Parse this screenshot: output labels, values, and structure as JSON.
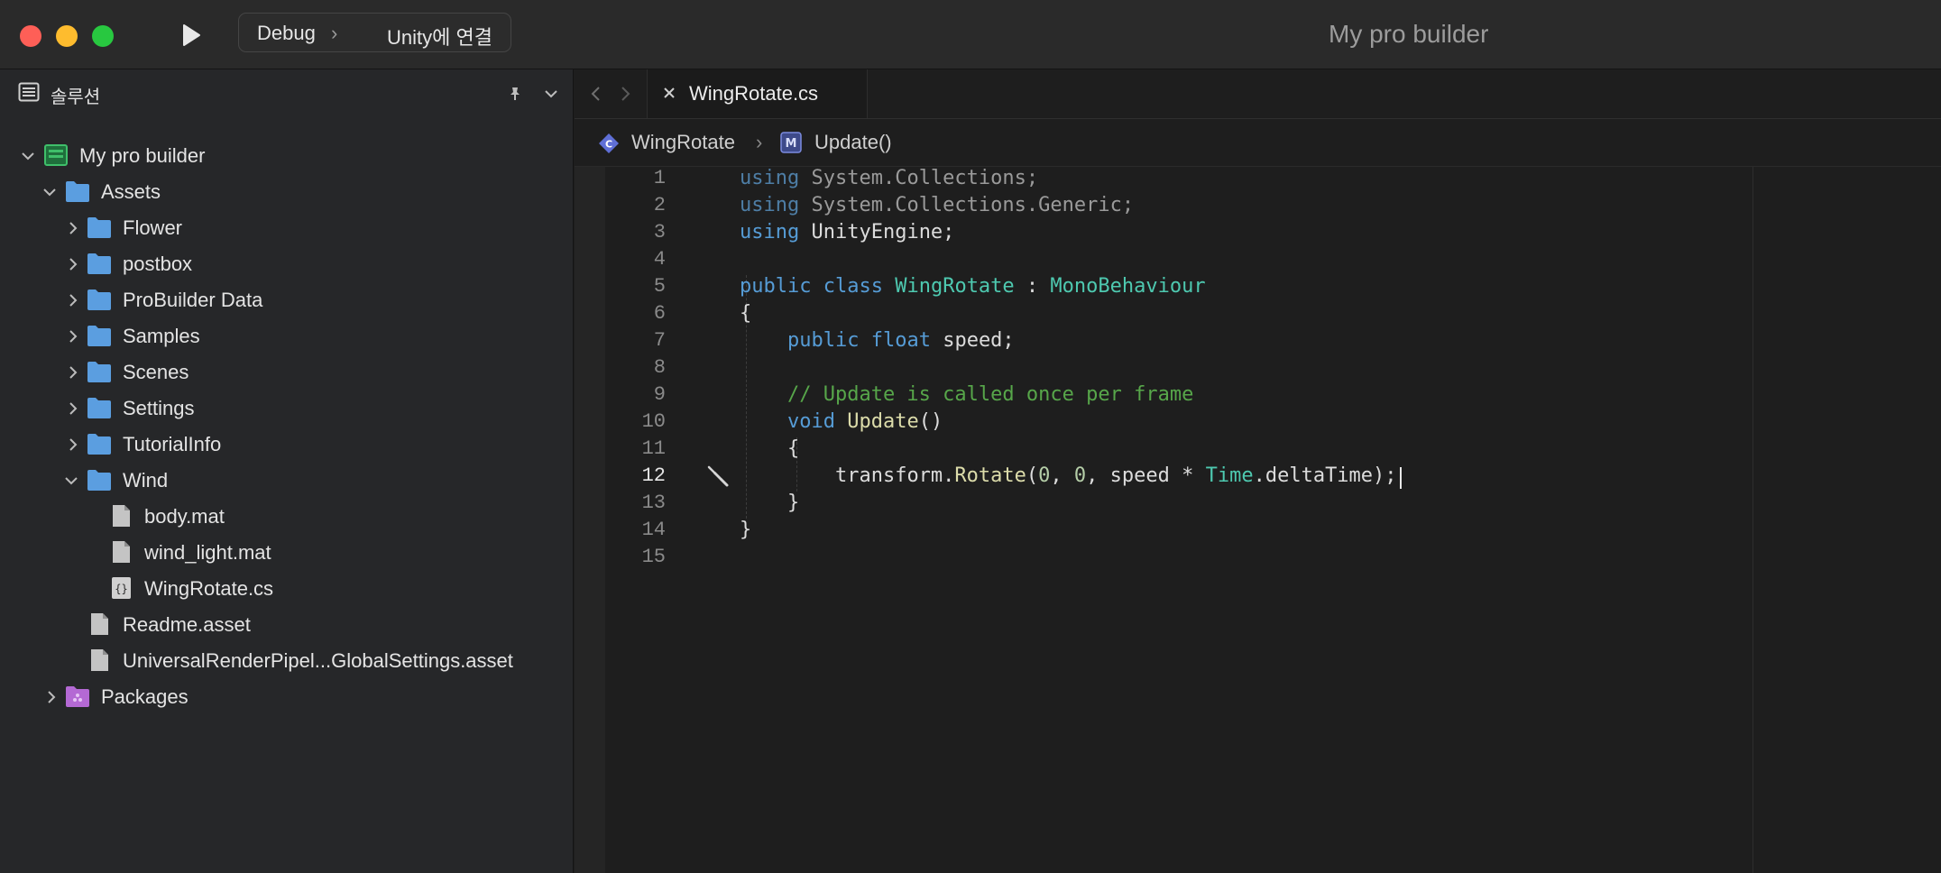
{
  "window": {
    "title": "My pro builder"
  },
  "toolbar": {
    "run_configuration": "Debug",
    "run_target": "Unity에 연결"
  },
  "sidebar": {
    "title": "솔루션",
    "tree": [
      {
        "label": "My pro builder",
        "type": "solution",
        "expanded": true
      },
      {
        "label": "Assets",
        "type": "folder",
        "expanded": true
      },
      {
        "label": "Flower",
        "type": "folder",
        "expanded": false
      },
      {
        "label": "postbox",
        "type": "folder",
        "expanded": false
      },
      {
        "label": "ProBuilder Data",
        "type": "folder",
        "expanded": false
      },
      {
        "label": "Samples",
        "type": "folder",
        "expanded": false
      },
      {
        "label": "Scenes",
        "type": "folder",
        "expanded": false
      },
      {
        "label": "Settings",
        "type": "folder",
        "expanded": false
      },
      {
        "label": "TutorialInfo",
        "type": "folder",
        "expanded": false
      },
      {
        "label": "Wind",
        "type": "folder",
        "expanded": true
      },
      {
        "label": "body.mat",
        "type": "file"
      },
      {
        "label": "wind_light.mat",
        "type": "file"
      },
      {
        "label": "WingRotate.cs",
        "type": "code-file"
      },
      {
        "label": "Readme.asset",
        "type": "file"
      },
      {
        "label": "UniversalRenderPipel...GlobalSettings.asset",
        "type": "file"
      },
      {
        "label": "Packages",
        "type": "package-folder",
        "expanded": false
      }
    ]
  },
  "editor": {
    "tab_label": "WingRotate.cs",
    "breadcrumb": {
      "class_name": "WingRotate",
      "separator": "›",
      "method_name": "Update()"
    },
    "active_line": 12,
    "line_numbers": [
      "1",
      "2",
      "3",
      "4",
      "5",
      "6",
      "7",
      "8",
      "9",
      "10",
      "11",
      "12",
      "13",
      "14",
      "15"
    ]
  },
  "code": {
    "l1": {
      "kw": "using",
      "ns": "System.Collections;"
    },
    "l2": {
      "kw": "using",
      "ns": "System.Collections.Generic;"
    },
    "l3": {
      "kw": "using",
      "ns": "UnityEngine;"
    },
    "l5": {
      "kw1": "public",
      "kw2": "class",
      "cls": "WingRotate",
      "colon": ":",
      "base": "MonoBehaviour"
    },
    "l6": {
      "brace": "{"
    },
    "l7": {
      "kw1": "public",
      "kw2": "float",
      "rest": "speed;"
    },
    "l9": {
      "comment": "// Update is called once per frame"
    },
    "l10": {
      "kw": "void",
      "name": "Update",
      "parens": "()"
    },
    "l11": {
      "brace": "{"
    },
    "l12": {
      "obj": "transform.",
      "call": "Rotate",
      "open": "(",
      "n1": "0",
      "c1": ", ",
      "n2": "0",
      "c2": ", speed * ",
      "time": "Time",
      "tail": ".deltaTime);"
    },
    "l13": {
      "brace": "}"
    },
    "l14": {
      "brace": "}"
    }
  },
  "colors": {
    "keyword": "#569cd6",
    "type": "#4ec9b0",
    "method": "#dcdcaa",
    "number": "#b5cea8",
    "comment": "#57a64a",
    "folder": "#5b9ee0",
    "package_folder": "#b469d4"
  },
  "icons": {
    "play": "play-icon",
    "sidebar": "sidebar-panel-icon",
    "pin": "pin-icon",
    "collapse": "chevron-down-icon",
    "folder": "folder-icon",
    "file": "file-icon",
    "code_file": "code-file-icon",
    "solution": "solution-icon",
    "package": "package-folder-icon",
    "class": "class-icon",
    "method": "method-icon",
    "tool": "screwdriver-icon"
  }
}
